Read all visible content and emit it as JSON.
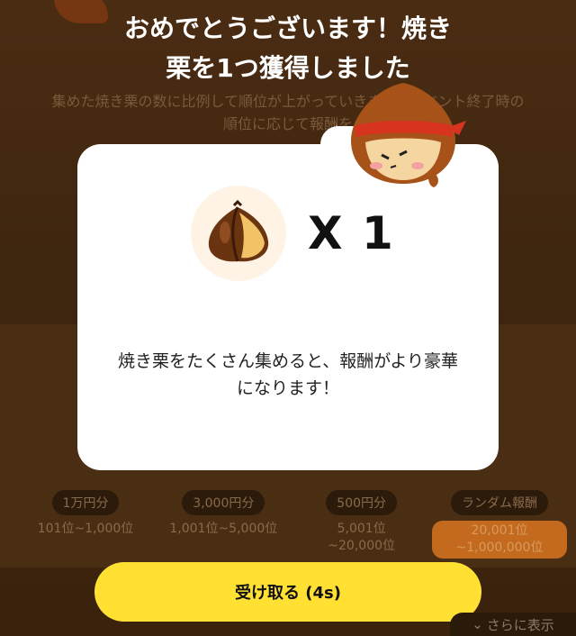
{
  "title_line1": "おめでとうございます！焼き",
  "title_line2": "栗を1つ獲得しました",
  "background": {
    "description": "集めた焼き栗の数に比例して順位が上がっていきます。イベント終了時の順位に応じて報酬を",
    "prizes": [
      {
        "label": "1万円分",
        "rank": "101位~1,000位"
      },
      {
        "label": "3,000円分",
        "rank": "1,001位~5,000位"
      },
      {
        "label": "500円分",
        "rank": "5,001位\n~20,000位"
      },
      {
        "label": "ランダム報酬",
        "rank": "20,001位\n~1,000,000位"
      }
    ]
  },
  "card": {
    "item_icon": "roasted-chestnut-icon",
    "quantity": "X 1",
    "message": "焼き栗をたくさん集めると、報酬がより豪華になります！"
  },
  "receive_button_label": "受け取る (4s)",
  "more_label": "さらに表示",
  "colors": {
    "button": "#ffe033",
    "card": "#ffffff",
    "overlay": "#3b2410"
  }
}
